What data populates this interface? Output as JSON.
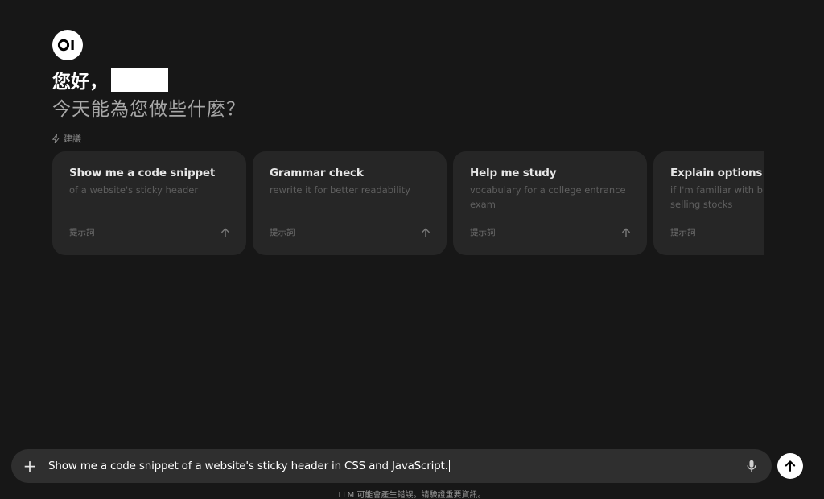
{
  "logo": {
    "text": "OI"
  },
  "greeting": {
    "hello": "您好，"
  },
  "subtitle": "今天能為您做些什麼？",
  "suggestions": {
    "label": "建議",
    "cards": [
      {
        "title": "Show me a code snippet",
        "subtitle": "of a website's sticky header",
        "tag": "提示詞"
      },
      {
        "title": "Grammar check",
        "subtitle": "rewrite it for better readability",
        "tag": "提示詞"
      },
      {
        "title": "Help me study",
        "subtitle": "vocabulary for a college entrance exam",
        "tag": "提示詞"
      },
      {
        "title": "Explain options trading",
        "subtitle": "if I'm familiar with buying and selling stocks",
        "tag": "提示詞"
      }
    ]
  },
  "composer": {
    "plus": "+",
    "value": "Show me a code snippet of a website's sticky header in CSS and JavaScript."
  },
  "disclaimer": "LLM 可能會產生錯誤。請驗證重要資訊。",
  "colors": {
    "background": "#171717",
    "card": "#262626",
    "composer": "#2f2f2f",
    "accent": "#ffffff"
  },
  "icons": [
    "zap-icon",
    "arrow-up-icon",
    "plus-icon",
    "mic-icon",
    "send-arrow-icon"
  ]
}
